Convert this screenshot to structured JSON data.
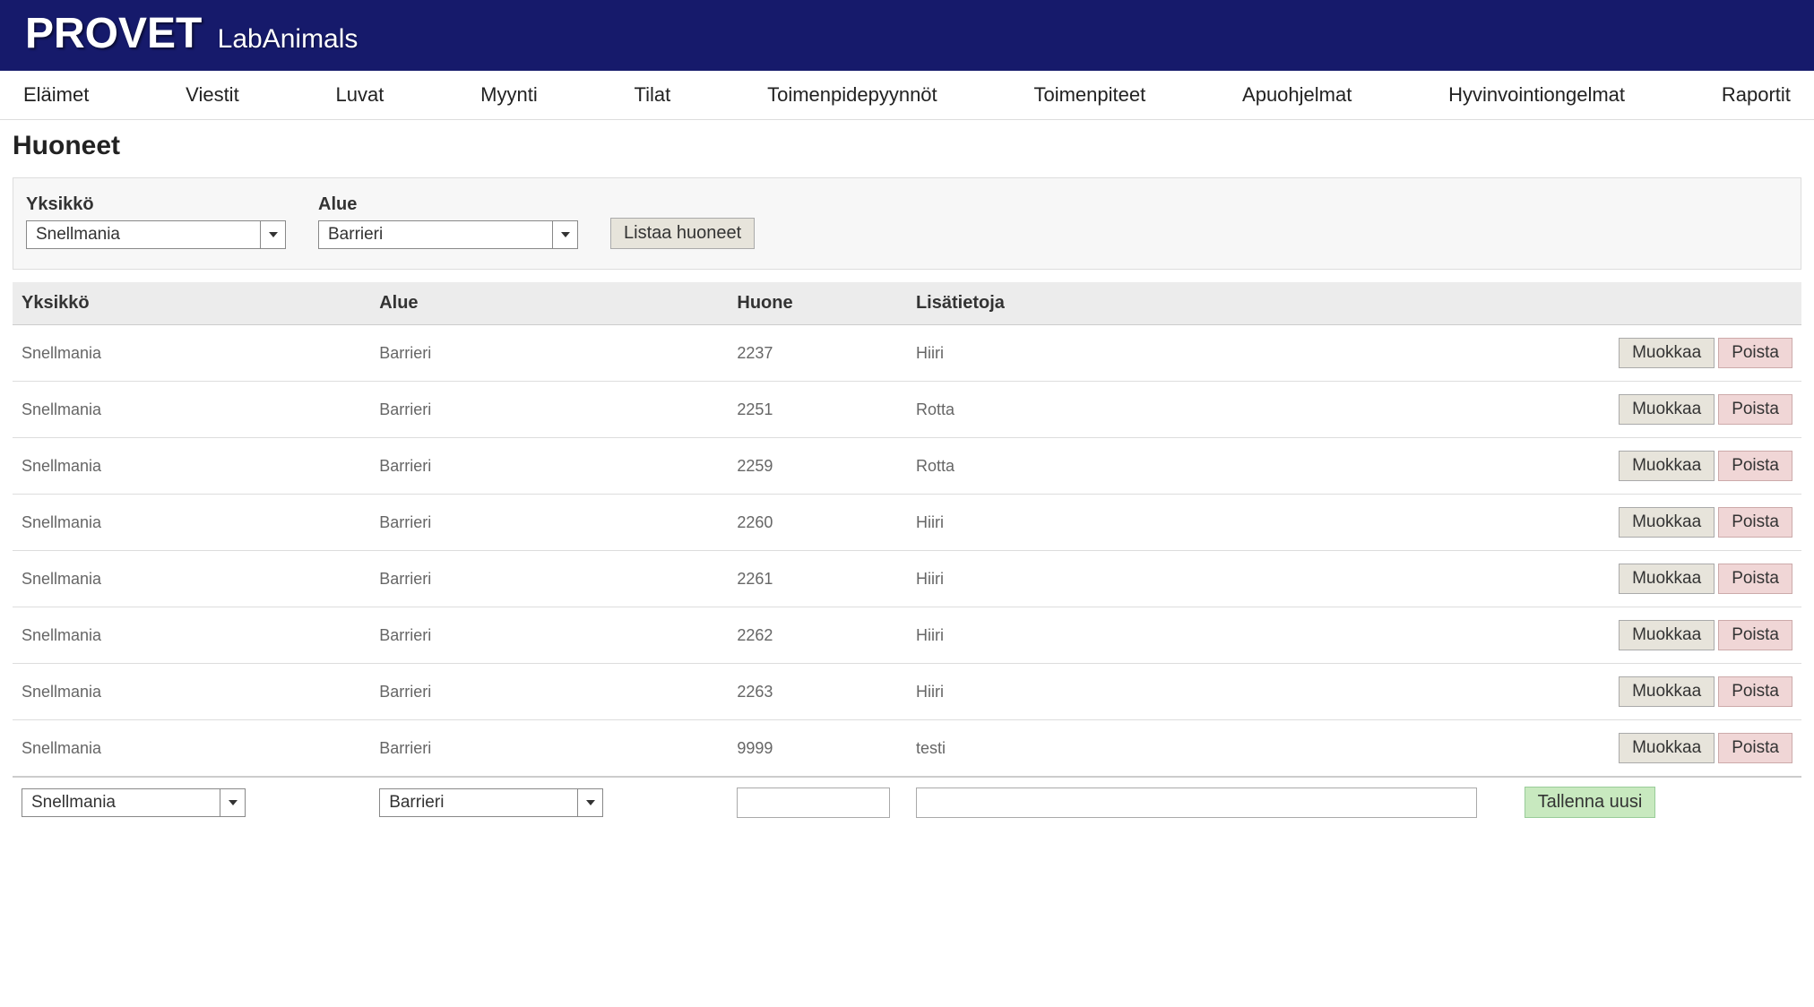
{
  "header": {
    "brand": "PROVET",
    "subtitle": "LabAnimals"
  },
  "menu": [
    "Eläimet",
    "Viestit",
    "Luvat",
    "Myynti",
    "Tilat",
    "Toimenpidepyynnöt",
    "Toimenpiteet",
    "Apuohjelmat",
    "Hyvinvointiongelmat",
    "Raportit"
  ],
  "page_title": "Huoneet",
  "filter": {
    "unit_label": "Yksikkö",
    "unit_value": "Snellmania",
    "area_label": "Alue",
    "area_value": "Barrieri",
    "list_button": "Listaa huoneet"
  },
  "columns": {
    "unit": "Yksikkö",
    "area": "Alue",
    "room": "Huone",
    "info": "Lisätietoja"
  },
  "row_buttons": {
    "edit": "Muokkaa",
    "delete": "Poista"
  },
  "rows": [
    {
      "unit": "Snellmania",
      "area": "Barrieri",
      "room": "2237",
      "info": "Hiiri"
    },
    {
      "unit": "Snellmania",
      "area": "Barrieri",
      "room": "2251",
      "info": "Rotta"
    },
    {
      "unit": "Snellmania",
      "area": "Barrieri",
      "room": "2259",
      "info": "Rotta"
    },
    {
      "unit": "Snellmania",
      "area": "Barrieri",
      "room": "2260",
      "info": "Hiiri"
    },
    {
      "unit": "Snellmania",
      "area": "Barrieri",
      "room": "2261",
      "info": "Hiiri"
    },
    {
      "unit": "Snellmania",
      "area": "Barrieri",
      "room": "2262",
      "info": "Hiiri"
    },
    {
      "unit": "Snellmania",
      "area": "Barrieri",
      "room": "2263",
      "info": "Hiiri"
    },
    {
      "unit": "Snellmania",
      "area": "Barrieri",
      "room": "9999",
      "info": "testi"
    }
  ],
  "new_row": {
    "unit_value": "Snellmania",
    "area_value": "Barrieri",
    "room_value": "",
    "info_value": "",
    "save_button": "Tallenna uusi"
  }
}
